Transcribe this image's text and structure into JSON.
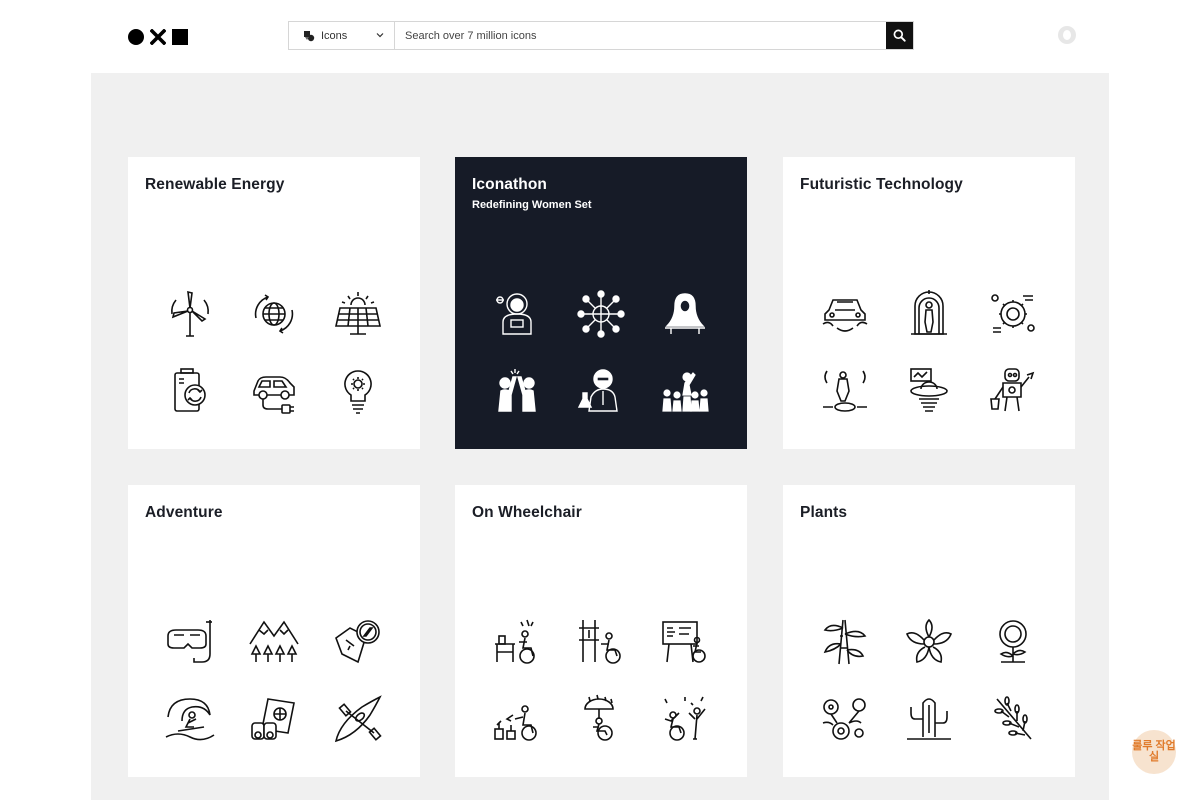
{
  "header": {
    "scope_label": "Icons",
    "search_placeholder": "Search over 7 million icons"
  },
  "cards": [
    {
      "title": "Renewable Energy",
      "subtitle": "",
      "theme": "light",
      "icons": [
        "wind-turbine-icon",
        "globe-recycle-icon",
        "solar-panel-icon",
        "battery-recharge-icon",
        "electric-car-icon",
        "smart-bulb-icon"
      ]
    },
    {
      "title": "Iconathon",
      "subtitle": "Redefining Women Set",
      "theme": "dark",
      "icons": [
        "astronaut-woman-icon",
        "global-network-icon",
        "woman-hijab-desk-icon",
        "high-five-icon",
        "woman-scientist-icon",
        "woman-leader-crowd-icon"
      ]
    },
    {
      "title": "Futuristic Technology",
      "subtitle": "",
      "theme": "light",
      "icons": [
        "flying-car-icon",
        "cryo-chamber-icon",
        "ai-brain-gear-icon",
        "teleport-person-icon",
        "ufo-hologram-icon",
        "robot-assistant-icon"
      ]
    },
    {
      "title": "Adventure",
      "subtitle": "",
      "theme": "light",
      "icons": [
        "snorkel-mask-icon",
        "mountains-forest-icon",
        "map-compass-icon",
        "surfer-wave-icon",
        "passport-binoculars-icon",
        "kayak-icon"
      ]
    },
    {
      "title": "On Wheelchair",
      "subtitle": "",
      "theme": "light",
      "icons": [
        "wheelchair-desk-icon",
        "wheelchair-work-icon",
        "wheelchair-presentation-icon",
        "wheelchair-gardening-icon",
        "wheelchair-umbrella-icon",
        "wheelchair-celebrate-icon"
      ]
    },
    {
      "title": "Plants",
      "subtitle": "",
      "theme": "light",
      "icons": [
        "bamboo-icon",
        "lotus-icon",
        "sunflower-icon",
        "flower-bouquet-icon",
        "cactus-icon",
        "willow-branch-icon"
      ]
    }
  ],
  "watermark": {
    "text": "룰루 작업실"
  }
}
